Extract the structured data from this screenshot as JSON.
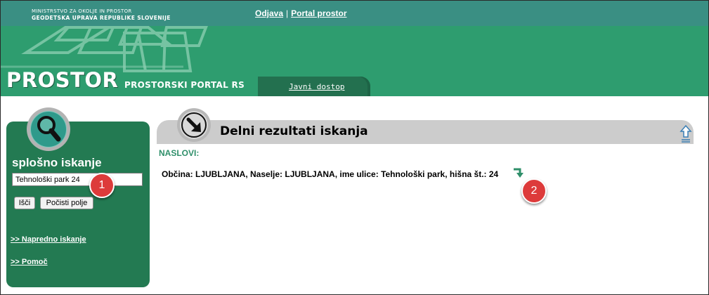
{
  "header": {
    "ministry_line1": "MINISTRSTVO ZA OKOLJE IN PROSTOR",
    "ministry_line2": "GEODETSKA UPRAVA REPUBLIKE SLOVENIJE",
    "logout_link": "Odjava",
    "separator": "|",
    "portal_link": "Portal prostor"
  },
  "banner": {
    "brand": "PROSTOR",
    "subtitle": "PROSTORSKI PORTAL RS",
    "tab_label": "Javni dostop"
  },
  "left_panel": {
    "icon": "magnifier-icon",
    "title": "splošno iskanje",
    "search_value": "Tehnološki park 24",
    "search_button": "Išči",
    "clear_button": "Počisti polje",
    "advanced_link": ">> Napredno iskanje",
    "help_link": ">> Pomoč"
  },
  "results": {
    "icon": "arrow-down-right-icon",
    "title": "Delni rezultati iskanja",
    "section_label": "NASLOVI:",
    "items": [
      {
        "text": "Občina: LJUBLJANA, Naselje: LJUBLJANA, ime ulice: Tehnološki park, hišna št.: 24",
        "link_icon": "go-arrow-icon"
      }
    ],
    "top_icon": "up-arrow-icon"
  },
  "markers": [
    "1",
    "2"
  ],
  "colors": {
    "topbar": "#3a8f83",
    "banner": "#2e9d6f",
    "panel": "#237a52",
    "accent_text": "#2f8f6a",
    "marker": "#dd3b3b"
  }
}
